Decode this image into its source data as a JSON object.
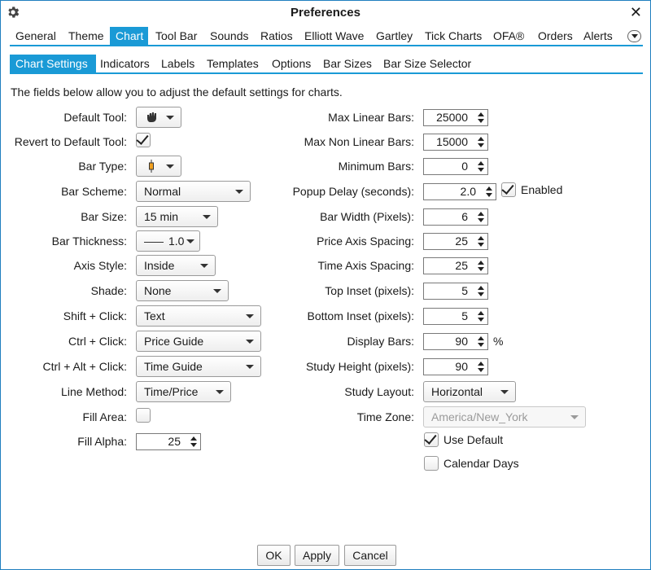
{
  "window": {
    "title": "Preferences"
  },
  "main_tabs": [
    {
      "label": "General"
    },
    {
      "label": "Theme"
    },
    {
      "label": "Chart"
    },
    {
      "label": "Tool Bar"
    },
    {
      "label": "Sounds"
    },
    {
      "label": "Ratios"
    },
    {
      "label": "Elliott Wave"
    },
    {
      "label": "Gartley"
    },
    {
      "label": "Tick Charts"
    },
    {
      "label": "OFA®"
    },
    {
      "label": "Orders"
    },
    {
      "label": "Alerts"
    }
  ],
  "sub_tabs": [
    {
      "label": "Chart Settings"
    },
    {
      "label": "Indicators"
    },
    {
      "label": "Labels"
    },
    {
      "label": "Templates"
    },
    {
      "label": "Options"
    },
    {
      "label": "Bar Sizes"
    },
    {
      "label": "Bar Size Selector"
    }
  ],
  "description": "The fields below allow you to adjust the default settings for charts.",
  "left": {
    "default_tool": {
      "label": "Default Tool:",
      "icon": "hand-icon"
    },
    "revert_default_tool": {
      "label": "Revert to Default Tool:",
      "checked": true
    },
    "bar_type": {
      "label": "Bar Type:",
      "icon": "candlestick-icon"
    },
    "bar_scheme": {
      "label": "Bar Scheme:",
      "value": "Normal"
    },
    "bar_size": {
      "label": "Bar Size:",
      "value": "15 min"
    },
    "bar_thickness": {
      "label": "Bar Thickness:",
      "value": "1.0"
    },
    "axis_style": {
      "label": "Axis Style:",
      "value": "Inside"
    },
    "shade": {
      "label": "Shade:",
      "value": "None"
    },
    "shift_click": {
      "label": "Shift + Click:",
      "value": "Text"
    },
    "ctrl_click": {
      "label": "Ctrl + Click:",
      "value": "Price Guide"
    },
    "ctrl_alt_click": {
      "label": "Ctrl + Alt + Click:",
      "value": "Time Guide"
    },
    "line_method": {
      "label": "Line Method:",
      "value": "Time/Price"
    },
    "fill_area": {
      "label": "Fill Area:",
      "checked": false
    },
    "fill_alpha": {
      "label": "Fill Alpha:",
      "value": "25"
    }
  },
  "right": {
    "max_linear_bars": {
      "label": "Max Linear Bars:",
      "value": "25000"
    },
    "max_non_linear_bars": {
      "label": "Max Non Linear Bars:",
      "value": "15000"
    },
    "minimum_bars": {
      "label": "Minimum Bars:",
      "value": "0"
    },
    "popup_delay": {
      "label": "Popup Delay (seconds):",
      "value": "2.0",
      "enabled_label": "Enabled",
      "enabled": true
    },
    "bar_width": {
      "label": "Bar Width (Pixels):",
      "value": "6"
    },
    "price_axis_spacing": {
      "label": "Price Axis Spacing:",
      "value": "25"
    },
    "time_axis_spacing": {
      "label": "Time Axis Spacing:",
      "value": "25"
    },
    "top_inset": {
      "label": "Top Inset (pixels):",
      "value": "5"
    },
    "bottom_inset": {
      "label": "Bottom Inset (pixels):",
      "value": "5"
    },
    "display_bars": {
      "label": "Display Bars:",
      "value": "90",
      "unit": "%"
    },
    "study_height": {
      "label": "Study Height (pixels):",
      "value": "90"
    },
    "study_layout": {
      "label": "Study Layout:",
      "value": "Horizontal"
    },
    "time_zone": {
      "label": "Time Zone:",
      "value": "America/New_York"
    },
    "use_default": {
      "label": "Use Default",
      "checked": true
    },
    "calendar_days": {
      "label": "Calendar Days",
      "checked": false
    }
  },
  "buttons": {
    "ok": "OK",
    "apply": "Apply",
    "cancel": "Cancel"
  }
}
